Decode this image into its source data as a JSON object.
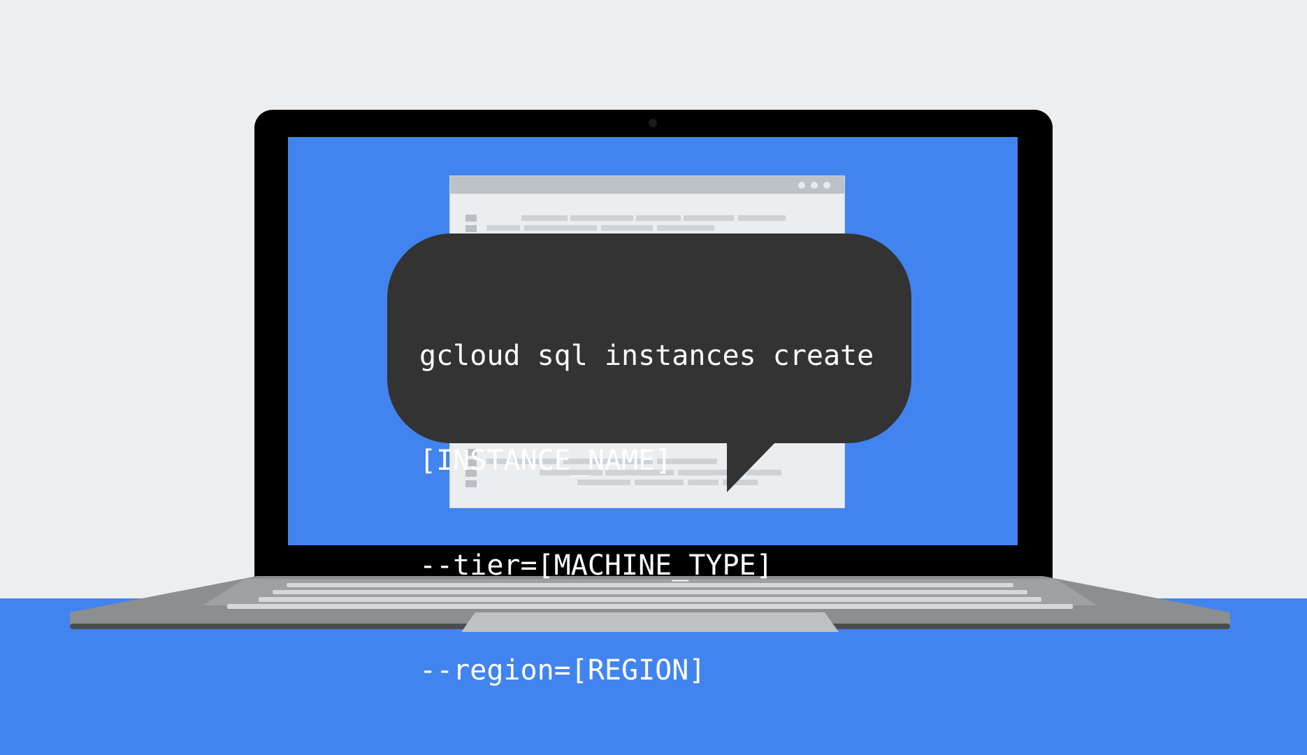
{
  "scene": {
    "colors": {
      "background": "#eceef0",
      "floor": "#4284ef",
      "screen": "#4284ef",
      "bezel": "#000000",
      "bubble": "#333333",
      "code_text": "#ffffff",
      "laptop_base": "#8a8c8e"
    }
  },
  "bubble": {
    "code_lines": [
      "gcloud sql instances create",
      "[INSTANCE_NAME]",
      "--tier=[MACHINE_TYPE]",
      "--region=[REGION]"
    ]
  }
}
